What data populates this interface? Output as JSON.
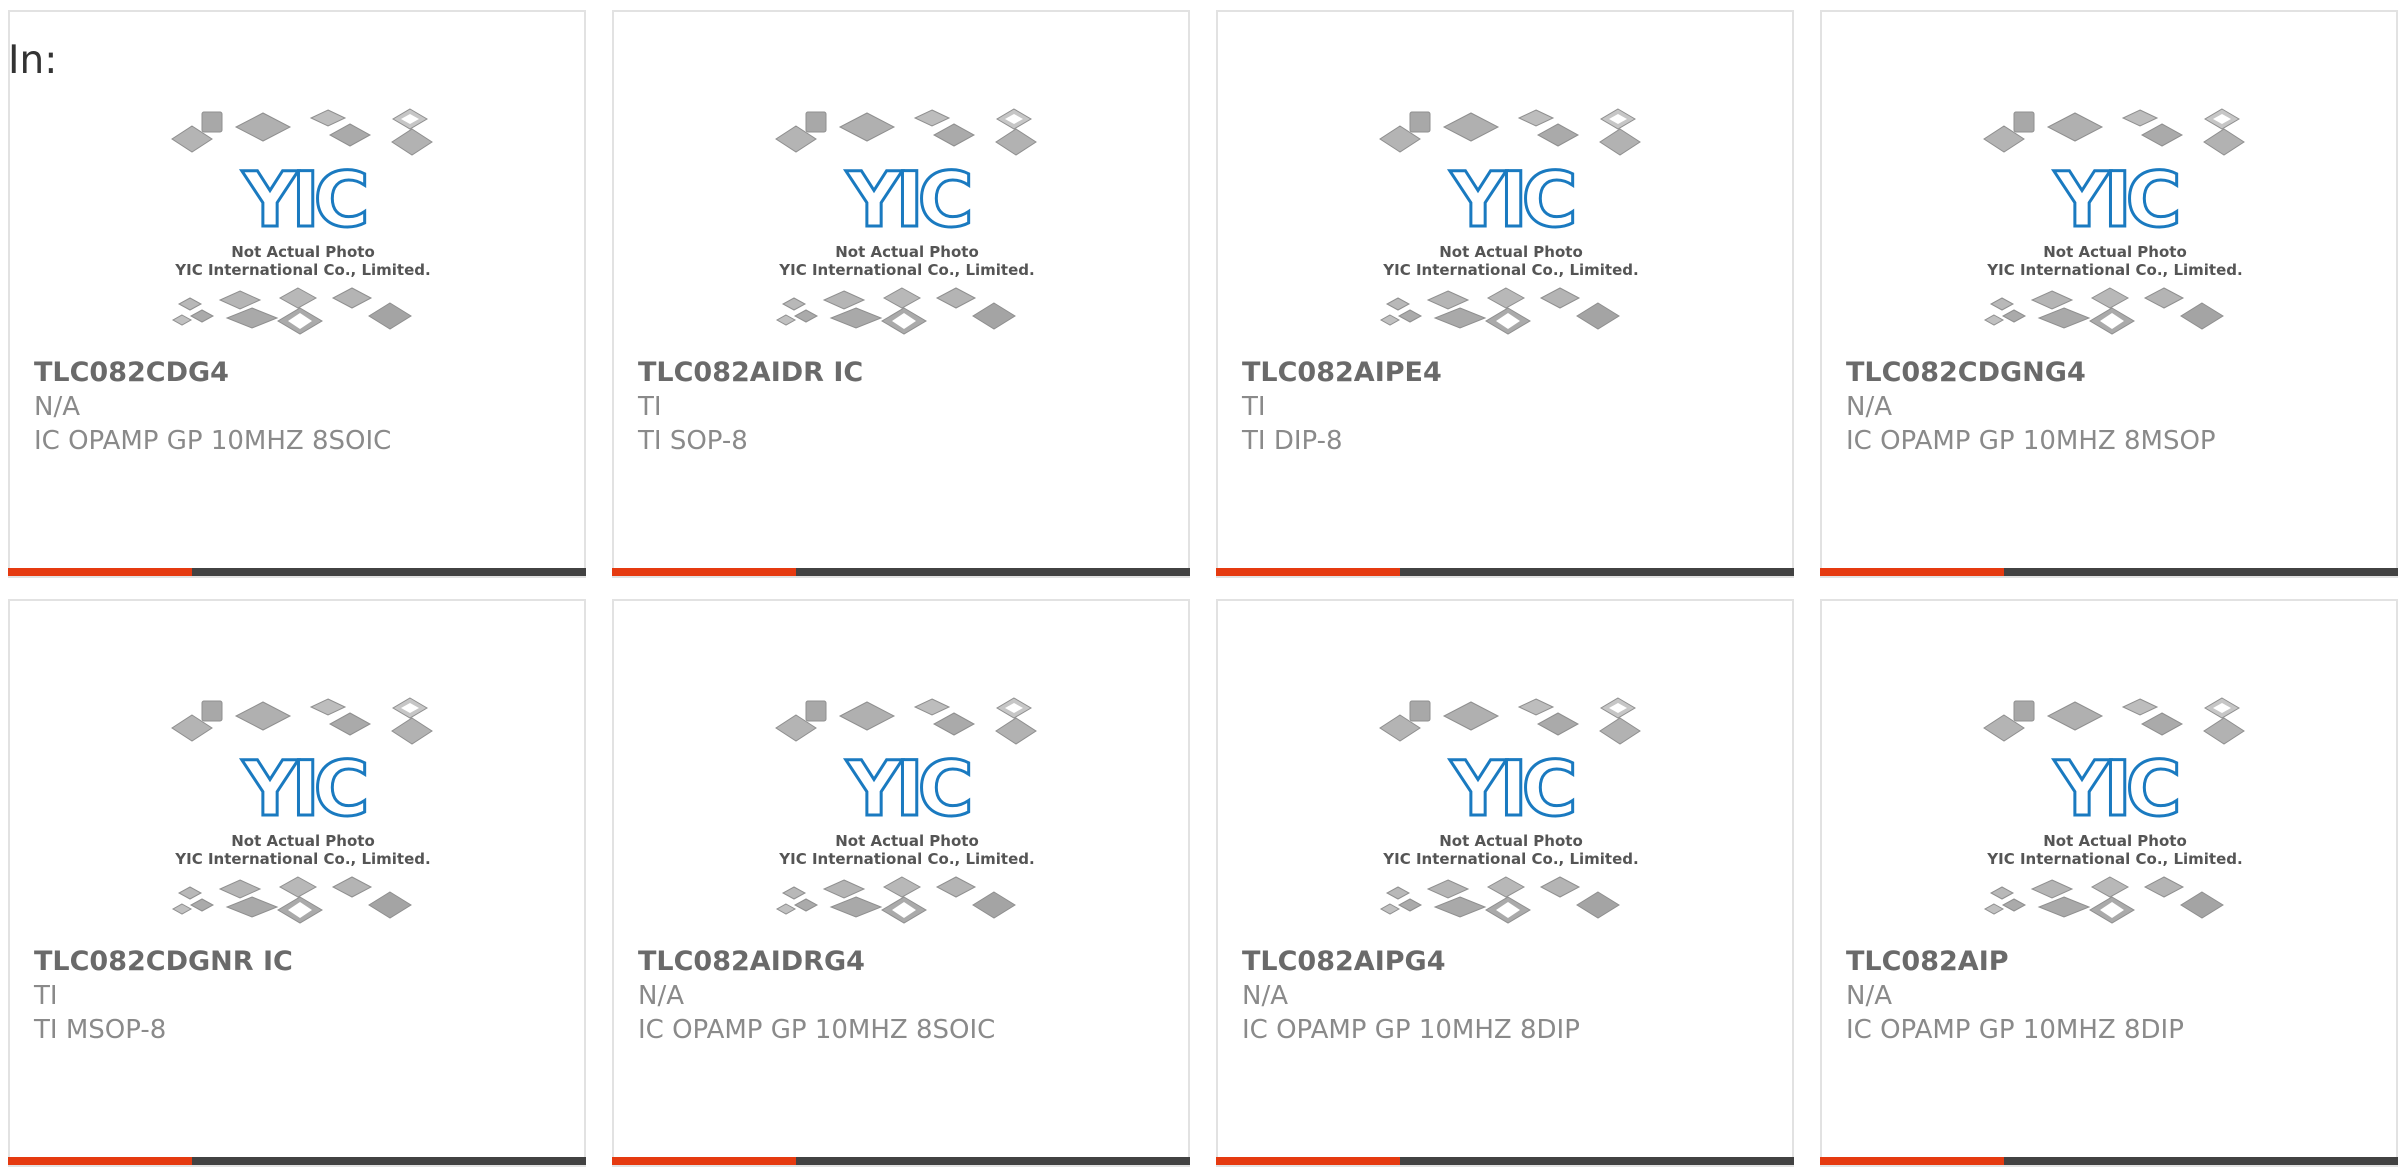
{
  "header": {
    "label": "In:"
  },
  "theme": {
    "accent": "#e53a10",
    "bar": "#424242",
    "logo_blue": "#1a7ac0"
  },
  "placeholder": {
    "line1": "Not Actual Photo",
    "line2": "YIC International Co., Limited.",
    "logo": "YIC"
  },
  "products": [
    {
      "part": "TLC082CDG4",
      "manufacturer": "N/A",
      "description": "IC OPAMP GP 10MHZ 8SOIC"
    },
    {
      "part": "TLC082AIDR IC",
      "manufacturer": "TI",
      "description": "TI SOP-8"
    },
    {
      "part": "TLC082AIPE4",
      "manufacturer": "TI",
      "description": "TI DIP-8"
    },
    {
      "part": "TLC082CDGNG4",
      "manufacturer": "N/A",
      "description": "IC OPAMP GP 10MHZ 8MSOP"
    },
    {
      "part": "TLC082CDGNR IC",
      "manufacturer": "TI",
      "description": "TI MSOP-8"
    },
    {
      "part": "TLC082AIDRG4",
      "manufacturer": "N/A",
      "description": "IC OPAMP GP 10MHZ 8SOIC"
    },
    {
      "part": "TLC082AIPG4",
      "manufacturer": "N/A",
      "description": "IC OPAMP GP 10MHZ 8DIP"
    },
    {
      "part": "TLC082AIP",
      "manufacturer": "N/A",
      "description": "IC OPAMP GP 10MHZ 8DIP"
    }
  ]
}
